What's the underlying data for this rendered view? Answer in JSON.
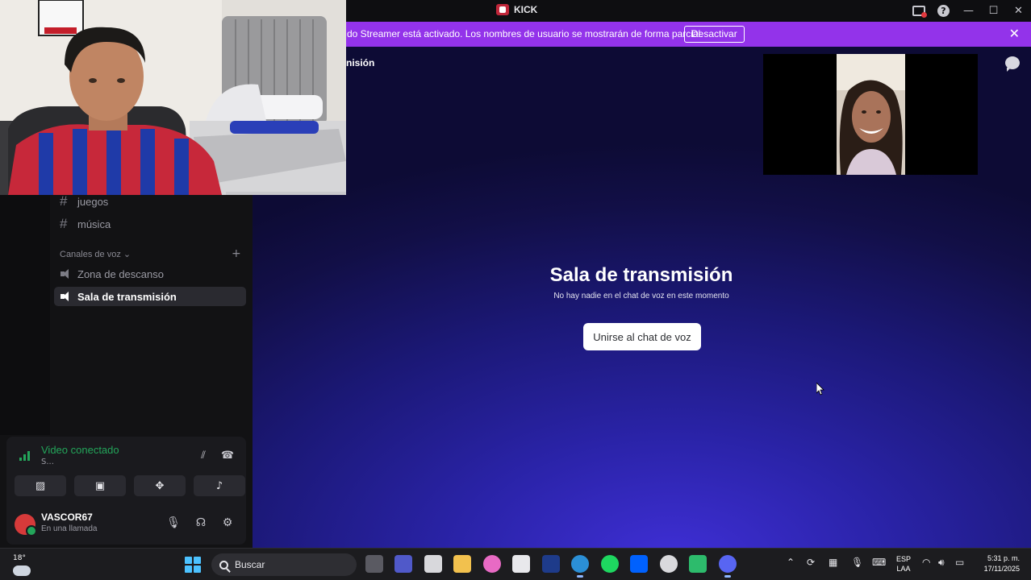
{
  "titlebar": {
    "app_name": "KICK"
  },
  "banner": {
    "text": "do Streamer está activado. Los nombres de usuario se mostrarán de forma parcial.",
    "button_label": "Desactivar"
  },
  "sidebar": {
    "channels": [
      {
        "label": "juegos",
        "type": "text"
      },
      {
        "label": "música",
        "type": "text"
      }
    ],
    "voice_category": "Canales de voz",
    "voice_channels": [
      {
        "label": "Zona de descanso"
      },
      {
        "label": "Sala de transmisión",
        "active": true
      }
    ]
  },
  "voice_panel": {
    "title": "Video conectado",
    "subtitle": "S..."
  },
  "user_panel": {
    "username": "VASCOR67",
    "status": "En una llamada"
  },
  "main": {
    "header_title": "nisión",
    "heading": "Sala de transmisión",
    "subheading": "No hay nadie en el chat de voz en este momento",
    "join_button": "Unirse al chat de voz"
  },
  "taskbar": {
    "temperature": "18°",
    "search_placeholder": "Buscar",
    "lang_top": "ESP",
    "lang_bottom": "LAA",
    "time": "5:31 p. m.",
    "date": "17/11/2025"
  },
  "colors": {
    "banner": "#9333ea",
    "connected_green": "#23a55a",
    "main_gradient_center": "#3f2fd6",
    "main_gradient_edge": "#0d0b35"
  }
}
